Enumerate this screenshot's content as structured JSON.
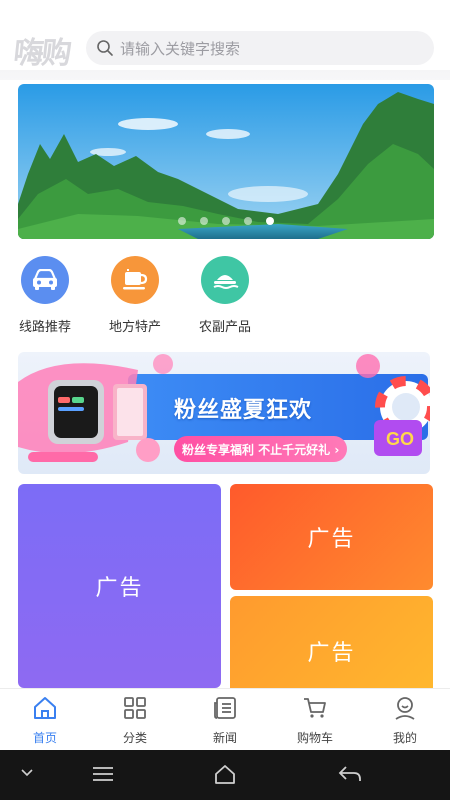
{
  "header": {
    "logo_text": "嗨购",
    "search_placeholder": "请输入关键字搜索"
  },
  "banner": {
    "slide_count": 5,
    "active_index": 0
  },
  "categories": [
    {
      "label": "线路推荐",
      "icon": "car-icon",
      "color": "#5b8ef0"
    },
    {
      "label": "地方特产",
      "icon": "cup-icon",
      "color": "#f7963a"
    },
    {
      "label": "农副产品",
      "icon": "boat-icon",
      "color": "#3fc6a4"
    }
  ],
  "promo": {
    "title": "粉丝盛夏狂欢",
    "subtitle": "粉丝专享福利 不止千元好礼 ›",
    "go_label": "GO"
  },
  "ads": [
    {
      "label": "广告"
    },
    {
      "label": "广告"
    },
    {
      "label": "广告"
    }
  ],
  "tabbar": {
    "active": "home",
    "items": [
      {
        "label": "首页",
        "icon": "home-icon"
      },
      {
        "label": "分类",
        "icon": "grid-icon"
      },
      {
        "label": "新闻",
        "icon": "news-icon"
      },
      {
        "label": "购物车",
        "icon": "cart-icon"
      },
      {
        "label": "我的",
        "icon": "profile-icon"
      }
    ]
  },
  "colors": {
    "accent": "#3a80f0",
    "ad_purple": "#7c6cf6",
    "ad_orange": "#ff6a2c",
    "ad_yellow": "#ffa92e"
  }
}
